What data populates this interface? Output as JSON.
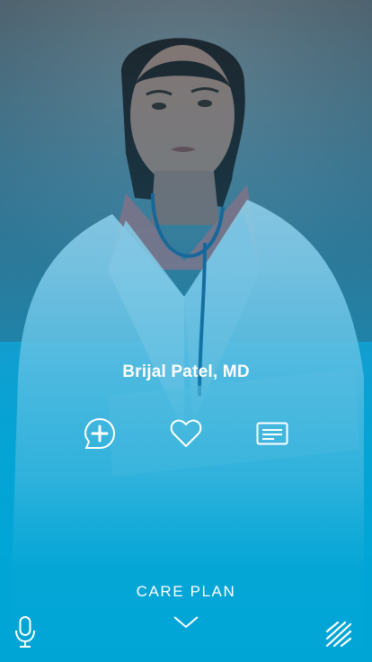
{
  "profile": {
    "name": "Brijal Patel, MD"
  },
  "actions": [
    {
      "icon": "add-message-icon"
    },
    {
      "icon": "heart-icon"
    },
    {
      "icon": "id-card-icon"
    }
  ],
  "bottom_bar": {
    "care_plan_label": "CARE PLAN",
    "chevron_icon": "chevron-down-icon",
    "mic_icon": "microphone-icon",
    "menu_icon": "menu-lines-icon"
  },
  "colors": {
    "accent": "#00a5d6",
    "foreground": "#ffffff"
  }
}
